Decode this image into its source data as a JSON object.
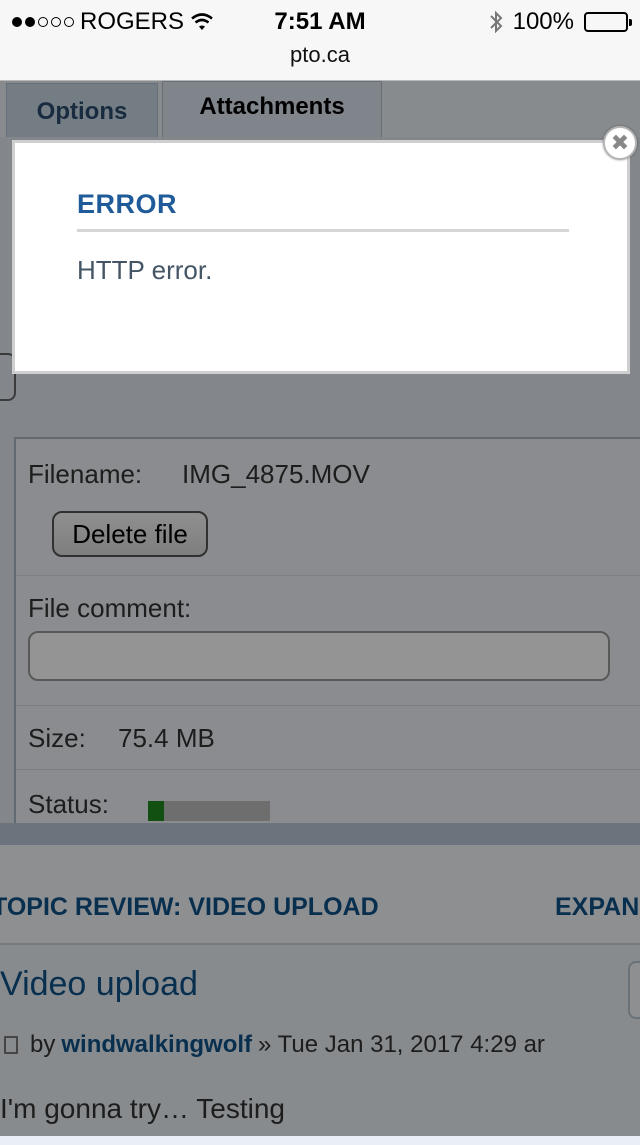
{
  "status_bar": {
    "carrier": "ROGERS",
    "time": "7:51 AM",
    "battery": "100%",
    "signal_icon": "signal-dots-icon",
    "wifi_icon": "wifi-icon",
    "bluetooth_icon": "bluetooth-icon"
  },
  "url_bar": {
    "url": "pto.ca"
  },
  "tabs": [
    {
      "label": "Options"
    },
    {
      "label": "Attachments"
    }
  ],
  "attachment": {
    "filename_label": "Filename:",
    "filename": "IMG_4875.MOV",
    "delete_label": "Delete file",
    "comment_label": "File comment:",
    "size_label": "Size:",
    "size": "75.4 MB",
    "status_label": "Status:",
    "status_progress": 0.13,
    "status_color": "#1e8a1e"
  },
  "review": {
    "title": "TOPIC REVIEW: VIDEO UPLOAD",
    "expand": "EXPAN"
  },
  "post": {
    "title": "Video upload",
    "by": "by",
    "author": "windwalkingwolf",
    "date": "» Tue Jan 31, 2017 4:29 ar",
    "body": "I'm gonna try… Testing"
  },
  "modal": {
    "title": "ERROR",
    "message": "HTTP error.",
    "close_icon": "close-icon"
  }
}
